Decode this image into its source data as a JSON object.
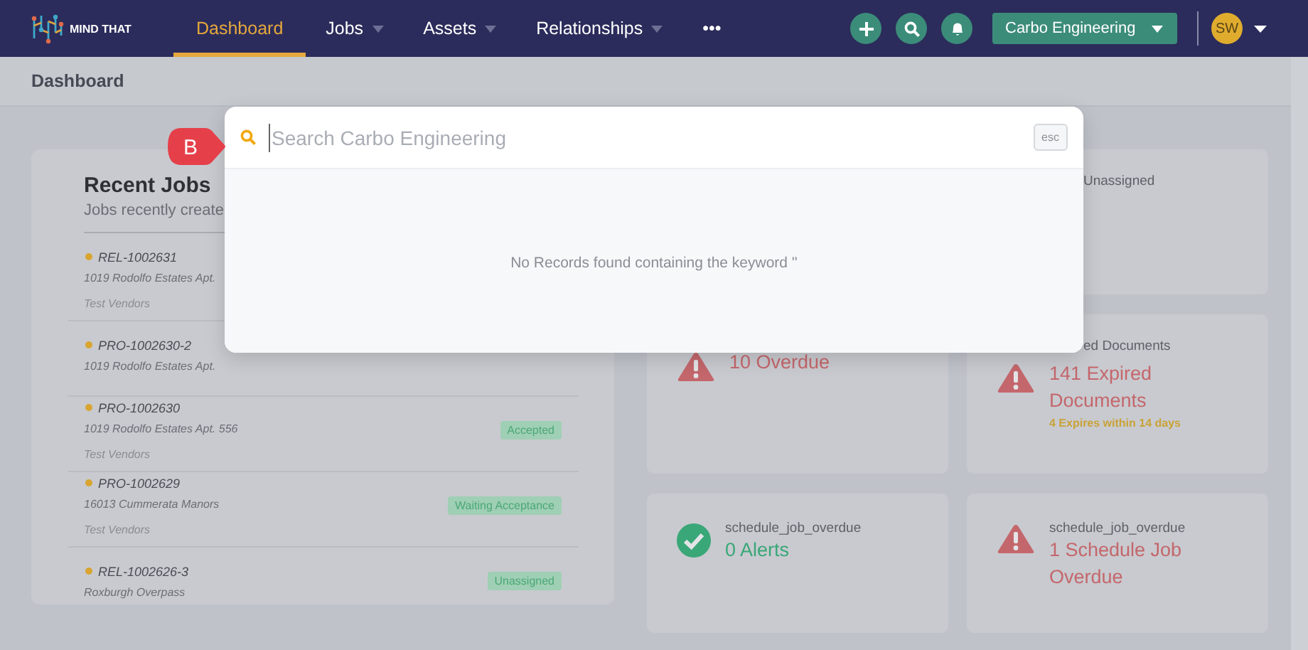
{
  "navbar": {
    "logo_text": "MIND THAT",
    "items": [
      {
        "label": "Dashboard",
        "selected": true,
        "dropdown": false
      },
      {
        "label": "Jobs",
        "selected": false,
        "dropdown": true
      },
      {
        "label": "Assets",
        "selected": false,
        "dropdown": true
      },
      {
        "label": "Relationships",
        "selected": false,
        "dropdown": true
      },
      {
        "label": "•••",
        "selected": false,
        "dropdown": false
      }
    ],
    "company_select": "Carbo Engineering",
    "avatar": "SW"
  },
  "page_title": "Dashboard",
  "recent_jobs": {
    "title": "Recent Jobs",
    "subtitle": "Jobs recently create",
    "jobs": [
      {
        "code": "REL-1002631",
        "address": "1019 Rodolfo Estates Apt.",
        "vendor": "Test Vendors"
      },
      {
        "code": "PRO-1002630-2",
        "address": "1019 Rodolfo Estates Apt."
      },
      {
        "code": "PRO-1002630",
        "address": "1019 Rodolfo Estates Apt. 556",
        "vendor": "Test Vendors",
        "status": "Accepted"
      },
      {
        "code": "PRO-1002629",
        "address": "16013 Cummerata Manors",
        "vendor": "Test Vendors",
        "status": "Waiting Acceptance"
      },
      {
        "code": "REL-1002626-3",
        "address": "Roxburgh Overpass",
        "status": "Unassigned"
      }
    ]
  },
  "stat_cards": [
    {
      "label": "Unassigned"
    },
    {
      "kind": "warning",
      "value": "10 Overdue"
    },
    {
      "label": "ed Documents",
      "kind": "warning",
      "value": "141 Expired Documents",
      "note": "4 Expires within 14 days"
    },
    {
      "label": "schedule_job_overdue",
      "kind": "success",
      "value": "0 Alerts"
    },
    {
      "label": "schedule_job_overdue",
      "kind": "warning",
      "value": "1 Schedule Job Overdue"
    }
  ],
  "search_modal": {
    "placeholder": "Search Carbo Engineering",
    "shortcut": "esc",
    "empty_message": "No Records found containing the keyword ''"
  },
  "callout": "B"
}
